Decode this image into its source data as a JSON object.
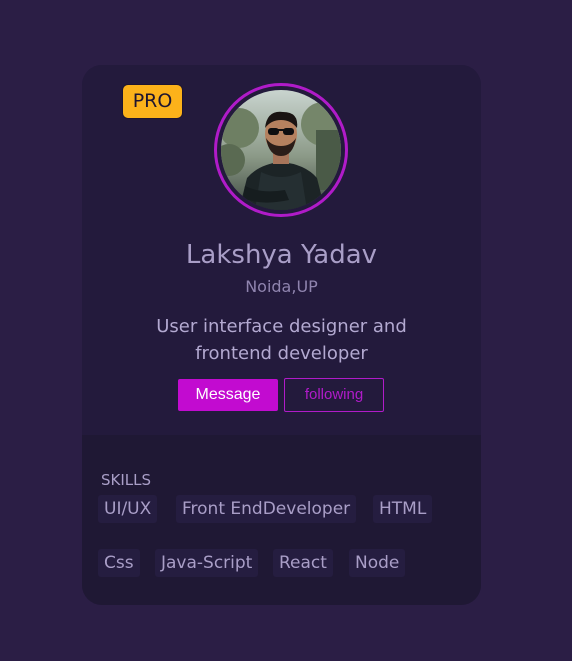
{
  "profile": {
    "badge": "PRO",
    "name": "Lakshya Yadav",
    "location": "Noida,UP",
    "bio": "User interface designer and frontend developer",
    "avatar": "avatar-photo"
  },
  "actions": {
    "message_label": "Message",
    "following_label": "following"
  },
  "skills": {
    "title": "SKILLS",
    "items": [
      "UI/UX",
      "Front EndDeveloper",
      "HTML",
      "Css",
      "Java-Script",
      "React",
      "Node"
    ]
  },
  "colors": {
    "background": "#2b1e45",
    "card": "#231a3c",
    "skills_panel": "#1f1834",
    "accent": "#c20bd0",
    "badge": "#fcb21a"
  }
}
